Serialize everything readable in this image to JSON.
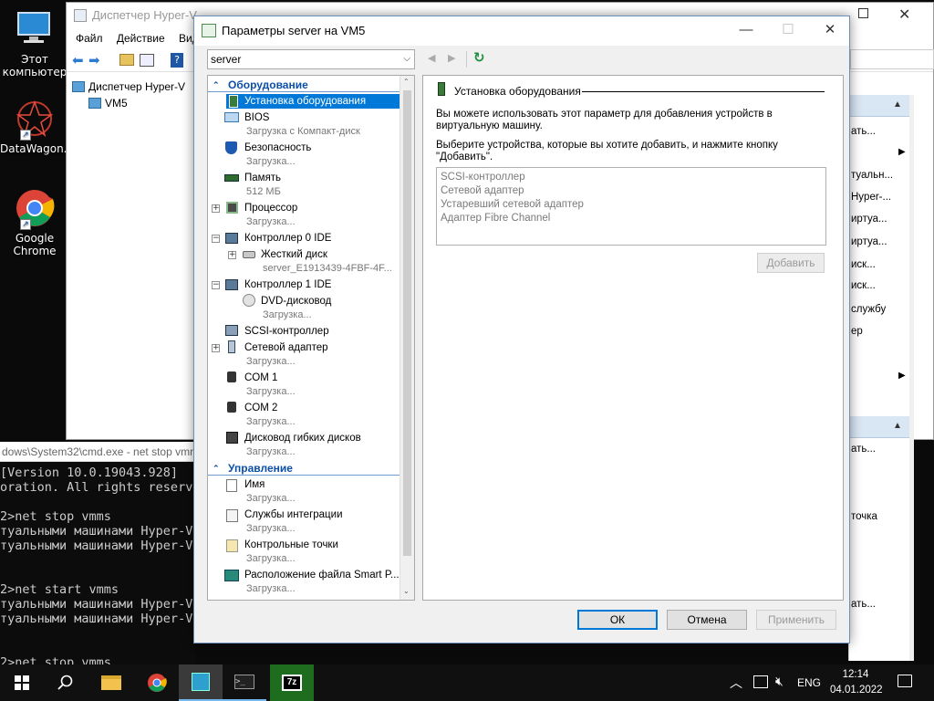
{
  "desktop": {
    "icons": [
      {
        "label_1": "Этот",
        "label_2": "компьютер",
        "icon": "this-pc-icon"
      },
      {
        "label_1": "DataWagon...",
        "icon": "datawagon-icon"
      },
      {
        "label_1": "Google",
        "label_2": "Chrome",
        "icon": "chrome-icon"
      }
    ]
  },
  "cmd": {
    "title": "dows\\System32\\cmd.exe - net  stop vmms",
    "lines": [
      "[Version 10.0.19043.928]",
      "oration. All rights reserved.",
      "",
      "2>net stop vmms",
      "туальными машинами Hyper-V",
      "туальными машинами Hyper-V",
      "",
      "",
      "2>net start vmms",
      "туальными машинами Hyper-V",
      "туальными машинами Hyper-V",
      "",
      "",
      "2>net stop vmms"
    ]
  },
  "hyperv_manager": {
    "title": "Диспетчер Hyper-V",
    "menu": [
      "Файл",
      "Действие",
      "Вид"
    ],
    "tree_root": "Диспетчер Hyper-V",
    "tree_child": "VM5"
  },
  "actions_panel": {
    "items_top": [
      "ать...",
      "туальн...",
      "Hyper-...",
      "иртуа...",
      "иртуа...",
      "иск...",
      "иск...",
      "службу",
      "ер"
    ],
    "items_bottom": [
      "ать...",
      "точка",
      "ать..."
    ]
  },
  "dialog": {
    "title": "Параметры server на VM5",
    "vm_selector": "server",
    "sections": {
      "hardware": "Оборудование",
      "management": "Управление"
    },
    "hardware_items": [
      {
        "label": "Установка оборудования",
        "sub": ""
      },
      {
        "label": "BIOS",
        "sub": "Загрузка с Компакт-диск"
      },
      {
        "label": "Безопасность",
        "sub": "Загрузка..."
      },
      {
        "label": "Память",
        "sub": "512 МБ"
      },
      {
        "label": "Процессор",
        "sub": "Загрузка..."
      },
      {
        "label": "Контроллер 0 IDE",
        "sub": ""
      },
      {
        "label": "Жесткий диск",
        "sub": "server_E1913439-4FBF-4F..."
      },
      {
        "label": "Контроллер 1 IDE",
        "sub": ""
      },
      {
        "label": "DVD-дисковод",
        "sub": "Загрузка..."
      },
      {
        "label": "SCSI-контроллер",
        "sub": ""
      },
      {
        "label": "Сетевой адаптер",
        "sub": "Загрузка..."
      },
      {
        "label": "COM 1",
        "sub": "Загрузка..."
      },
      {
        "label": "COM 2",
        "sub": "Загрузка..."
      },
      {
        "label": "Дисковод гибких дисков",
        "sub": "Загрузка..."
      }
    ],
    "management_items": [
      {
        "label": "Имя",
        "sub": "Загрузка..."
      },
      {
        "label": "Службы интеграции",
        "sub": "Загрузка..."
      },
      {
        "label": "Контрольные точки",
        "sub": "Загрузка..."
      },
      {
        "label": "Расположение файла Smart P...",
        "sub": "Загрузка..."
      }
    ],
    "right_pane": {
      "header": "Установка оборудования",
      "desc1": "Вы можете использовать этот параметр для добавления устройств в виртуальную машину.",
      "desc2": "Выберите устройства, которые вы хотите добавить, и нажмите кнопку \"Добавить\".",
      "devices": [
        "SCSI-контроллер",
        "Сетевой адаптер",
        "Устаревший сетевой адаптер",
        "Адаптер Fibre Channel"
      ],
      "add_button": "Добавить"
    },
    "buttons": {
      "ok": "ОК",
      "cancel": "Отмена",
      "apply": "Применить"
    }
  },
  "taskbar": {
    "language": "ENG",
    "time": "12:14",
    "date": "04.01.2022"
  }
}
